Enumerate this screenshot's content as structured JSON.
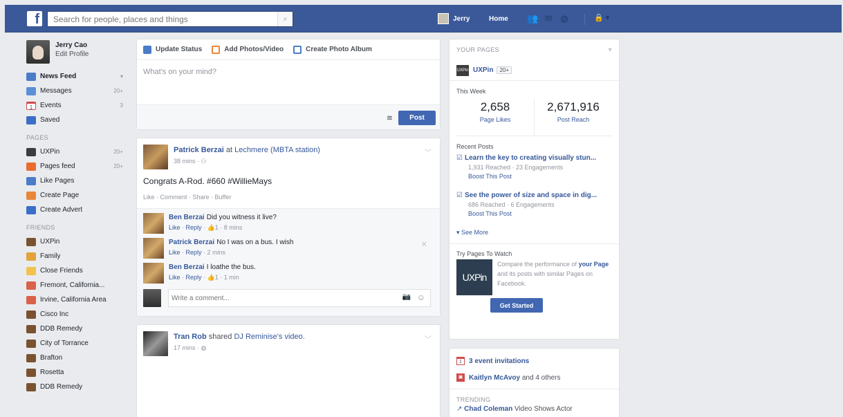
{
  "topbar": {
    "logo": "f",
    "search_placeholder": "Search for people, places and things",
    "search_icon": "search-icon",
    "user": "Jerry",
    "home": "Home",
    "icons": [
      "friend-requests-icon",
      "messages-icon",
      "notifications-icon"
    ],
    "settings_icon": "settings-icon"
  },
  "profile": {
    "name": "Jerry Cao",
    "edit": "Edit Profile"
  },
  "nav": [
    {
      "label": "News Feed",
      "count": "",
      "icon": "news-feed-icon",
      "color": "#4a7cc7"
    },
    {
      "label": "Messages",
      "count": "20+",
      "icon": "messages-icon",
      "color": "#5b8fd6"
    },
    {
      "label": "Events",
      "count": "3",
      "icon": "calendar-icon",
      "color": "#e8e8e8"
    },
    {
      "label": "Saved",
      "count": "",
      "icon": "bookmark-icon",
      "color": "#3b6ec7"
    }
  ],
  "pages_section": {
    "title": "PAGES",
    "items": [
      {
        "label": "UXPin",
        "count": "20+",
        "color": "#3c3c3c"
      },
      {
        "label": "Pages feed",
        "count": "20+",
        "color": "#e86d2f"
      },
      {
        "label": "Like Pages",
        "count": "",
        "color": "#4a7cc7"
      },
      {
        "label": "Create Page",
        "count": "",
        "color": "#e8863a"
      },
      {
        "label": "Create Advert",
        "count": "",
        "color": "#3b6ec7"
      }
    ]
  },
  "friends_section": {
    "title": "FRIENDS",
    "items": [
      {
        "label": "UXPin",
        "color": "#7a5230"
      },
      {
        "label": "Family",
        "color": "#e3a23b"
      },
      {
        "label": "Close Friends",
        "color": "#f2c14e"
      },
      {
        "label": "Fremont, California...",
        "color": "#d8624a"
      },
      {
        "label": "Irvine, California Area",
        "color": "#d8624a"
      },
      {
        "label": "Cisco Inc",
        "color": "#7a5230"
      },
      {
        "label": "DDB Remedy",
        "color": "#7a5230"
      },
      {
        "label": "City of Torrance",
        "color": "#7a5230"
      },
      {
        "label": "Brafton",
        "color": "#7a5230"
      },
      {
        "label": "Rosetta",
        "color": "#7a5230"
      },
      {
        "label": "DDB Remedy",
        "color": "#7a5230"
      }
    ]
  },
  "composer": {
    "tabs": [
      {
        "label": "Update Status",
        "icon": "edit-icon",
        "color": "#4a7cc7"
      },
      {
        "label": "Add Photos/Video",
        "icon": "photo-icon",
        "color": "#e8863a"
      },
      {
        "label": "Create Photo Album",
        "icon": "album-icon",
        "color": "#4a7cc7"
      }
    ],
    "placeholder": "What's on your mind?",
    "audience_icon": "layers-icon",
    "post_label": "Post"
  },
  "post1": {
    "author": "Patrick Berzai",
    "at": "at",
    "place": "Lechmere (MBTA station)",
    "time": "38 mins",
    "text": "Congrats A-Rod. #660 #WillieMays",
    "actions": "Like · Comment · Share · Buffer",
    "comments": [
      {
        "name": "Ben Berzai",
        "text": "Did you witness it live?",
        "meta": "1 · 8 mins"
      },
      {
        "name": "Patrick Berzai",
        "text": "No I was on a bus. I wish",
        "meta": "2 mins"
      },
      {
        "name": "Ben Berzai",
        "text": "I loathe the bus.",
        "meta": "1 · 1 min"
      }
    ],
    "comment_placeholder": "Write a comment..."
  },
  "post2": {
    "author": "Tran Rob",
    "shared": "shared",
    "target": "DJ Reminise's video.",
    "time": "17 mins"
  },
  "right": {
    "your_pages": "YOUR PAGES",
    "page_name": "UXPin",
    "page_badge": "20+",
    "this_week": "This Week",
    "stat1_num": "2,658",
    "stat1_lbl": "Page Likes",
    "stat2_num": "2,671,916",
    "stat2_lbl": "Post Reach",
    "recent_posts": "Recent Posts",
    "posts": [
      {
        "title": "Learn the key to creating visually stun...",
        "stats": "1,931 Reached · 23 Engagements",
        "boost": "Boost This Post"
      },
      {
        "title": "See the power of size and space in dig...",
        "stats": "686 Reached · 6 Engagements",
        "boost": "Boost This Post"
      }
    ],
    "see_more": "See More",
    "try_pages": "Try Pages To Watch",
    "watch_logo": "UXPin",
    "watch_text_1": "Compare the performance of",
    "watch_bold_1": "your",
    "watch_bold_2": "Page",
    "watch_text_2": "and its posts with similar Pages on Facebook.",
    "get_started": "Get Started"
  },
  "events": {
    "invites": "3 event invitations",
    "birthday_name": "Kaitlyn McAvoy",
    "birthday_rest": "and 4 others",
    "trending": "TRENDING",
    "trend_name": "Chad Coleman",
    "trend_text": "Video Shows Actor"
  }
}
